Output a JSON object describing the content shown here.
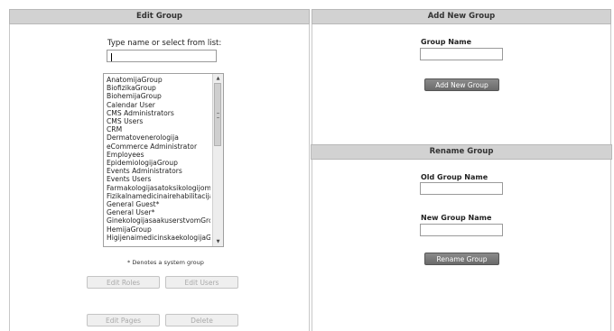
{
  "edit_group": {
    "title": "Edit Group",
    "prompt": "Type name or select from list:",
    "search_value": "",
    "groups": [
      "AnatomijaGroup",
      "BiofizikaGroup",
      "BiohemijaGroup",
      "Calendar User",
      "CMS Administrators",
      "CMS Users",
      "CRM",
      "Dermatovenerologija",
      "eCommerce Administrator",
      "Employees",
      "EpidemiologijaGroup",
      "Events Administrators",
      "Events Users",
      "FarmakologijasatoksikologijomGr",
      "Fizikalnamedicinairehabilitacija",
      "General Guest*",
      "General User*",
      "GinekologijasaakuserstvomGroup",
      "HemijaGroup",
      "HigijenaimedicinskaekologijaGrou"
    ],
    "system_note": "* Denotes a system group",
    "buttons": {
      "edit_roles": "Edit Roles",
      "edit_users": "Edit Users",
      "edit_pages": "Edit Pages",
      "delete": "Delete"
    }
  },
  "add_group": {
    "title": "Add New Group",
    "name_label": "Group Name",
    "name_value": "",
    "button": "Add New Group"
  },
  "rename_group": {
    "title": "Rename Group",
    "old_label": "Old Group Name",
    "old_value": "",
    "new_label": "New Group Name",
    "new_value": "",
    "button": "Rename Group"
  },
  "icons": {
    "scroll_up": "▲",
    "scroll_down": "▼"
  }
}
